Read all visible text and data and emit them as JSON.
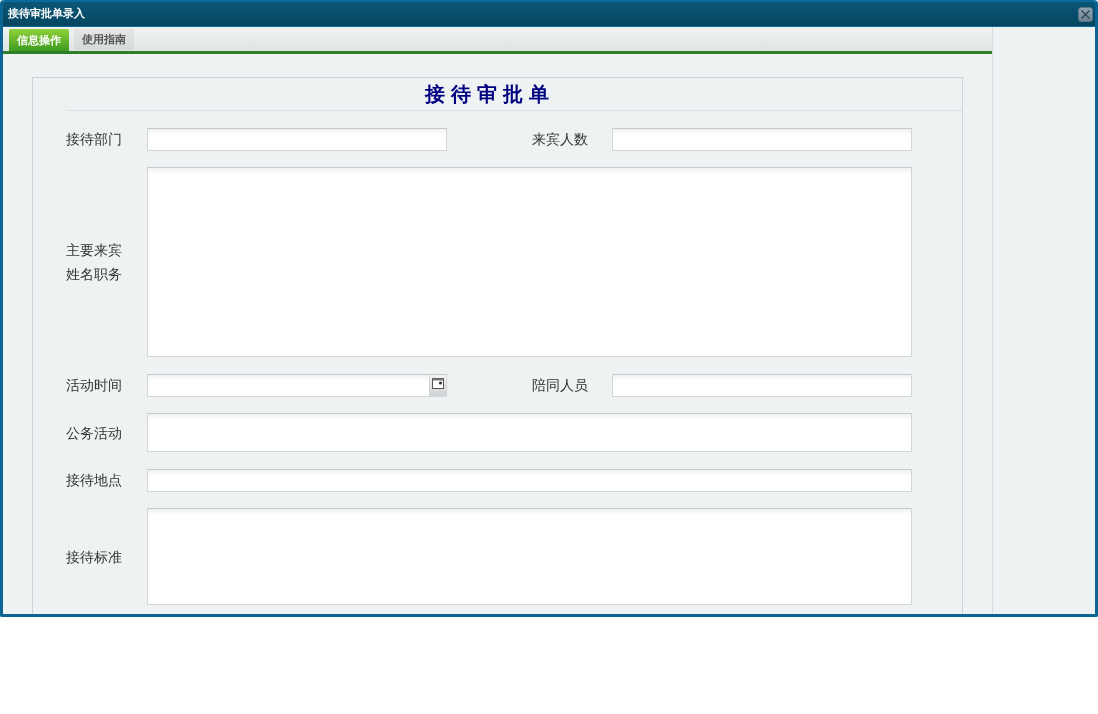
{
  "window": {
    "title": "接待审批单录入"
  },
  "tabs": [
    {
      "label": "信息操作",
      "selected": true
    },
    {
      "label": "使用指南",
      "selected": false
    }
  ],
  "form": {
    "title": "接待审批单",
    "rows": [
      {
        "fields": [
          {
            "label": "接待部门",
            "kind": "text"
          },
          {
            "label": "来宾人数",
            "kind": "text"
          }
        ]
      },
      {
        "fields": [
          {
            "label": "主要来宾姓名职务",
            "kind": "textarea"
          }
        ]
      },
      {
        "fields": [
          {
            "label": "活动时间",
            "kind": "date"
          },
          {
            "label": "陪同人员",
            "kind": "text"
          }
        ]
      },
      {
        "fields": [
          {
            "label": "公务活动",
            "kind": "textarea"
          }
        ]
      },
      {
        "fields": [
          {
            "label": "接待地点",
            "kind": "text"
          }
        ]
      },
      {
        "fields": [
          {
            "label": "接待标准",
            "kind": "textarea"
          }
        ]
      }
    ]
  }
}
